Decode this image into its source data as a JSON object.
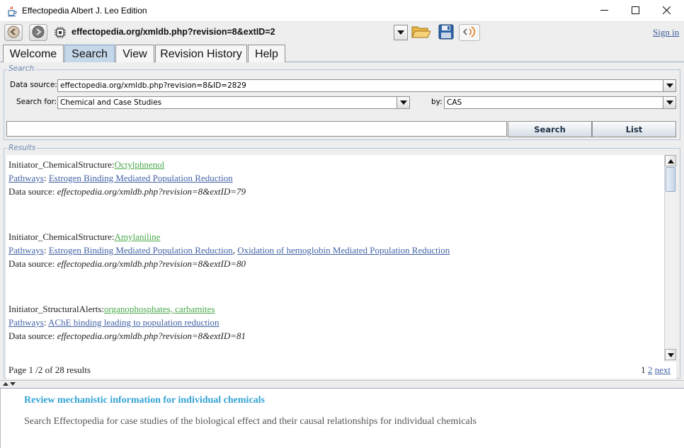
{
  "window": {
    "title": "Effectopedia  Albert J. Leo Edition",
    "app_icon": "java-cup-icon",
    "minimize_icon": "minimize-icon",
    "maximize_icon": "maximize-icon",
    "close_icon": "close-icon"
  },
  "toolbar": {
    "back_icon": "back-arrow-icon",
    "forward_icon": "forward-arrow-icon",
    "page_icon": "chip-icon",
    "url": "effectopedia.org/xmldb.php?revision=8&extID=2",
    "open_icon": "folder-icon",
    "save_icon": "floppy-disk-icon",
    "sound_icon": "speaker-icon",
    "sign_in": "Sign in"
  },
  "tabs": [
    {
      "label": "Welcome",
      "active": false
    },
    {
      "label": "Search",
      "active": true
    },
    {
      "label": "View",
      "active": false
    },
    {
      "label": "Revision History",
      "active": false
    },
    {
      "label": "Help",
      "active": false
    }
  ],
  "search": {
    "group_title": "Search",
    "data_source_label": "Data source:",
    "data_source_value": "effectopedia.org/xmldb.php?revision=8&ID=2829",
    "search_for_label": "Search for:",
    "search_for_value": "Chemical and Case Studies",
    "by_label": "by:",
    "by_value": "CAS",
    "query": "",
    "search_button": "Search",
    "list_button": "List"
  },
  "results": {
    "group_title": "Results",
    "items": [
      {
        "kind_label": "Initiator_ChemicalStructure:",
        "name": "Octylphnenol",
        "pathways_label": "Pathways",
        "pathways": [
          "Estrogen Binding Mediated Population Reduction"
        ],
        "source_label": "Data source:",
        "source": "effectopedia.org/xmldb.php?revision=8&extID=79"
      },
      {
        "kind_label": "Initiator_ChemicalStructure:",
        "name": "Amylaniline",
        "pathways_label": "Pathways",
        "pathways": [
          "Estrogen Binding Mediated Population Reduction",
          "Oxidation of hemoglobin Mediated Population Reduction"
        ],
        "source_label": "Data source:",
        "source": "effectopedia.org/xmldb.php?revision=8&extID=80"
      },
      {
        "kind_label": "Initiator_StructuralAlerts:",
        "name": "organophosphates, carbamites",
        "pathways_label": "Pathways",
        "pathways": [
          "AChE binding leading to population reduction"
        ],
        "source_label": "Data source:",
        "source": "effectopedia.org/xmldb.php?revision=8&extID=81"
      }
    ],
    "page_info": "Page 1 /2 of 28 results",
    "page_current": "1",
    "page_link": "2",
    "next_link": "next"
  },
  "info": {
    "title": "Review mechanistic information for individual chemicals",
    "text": "Search Effectopedia for case studies of the biological effect and their causal relationships for individual chemicals"
  }
}
